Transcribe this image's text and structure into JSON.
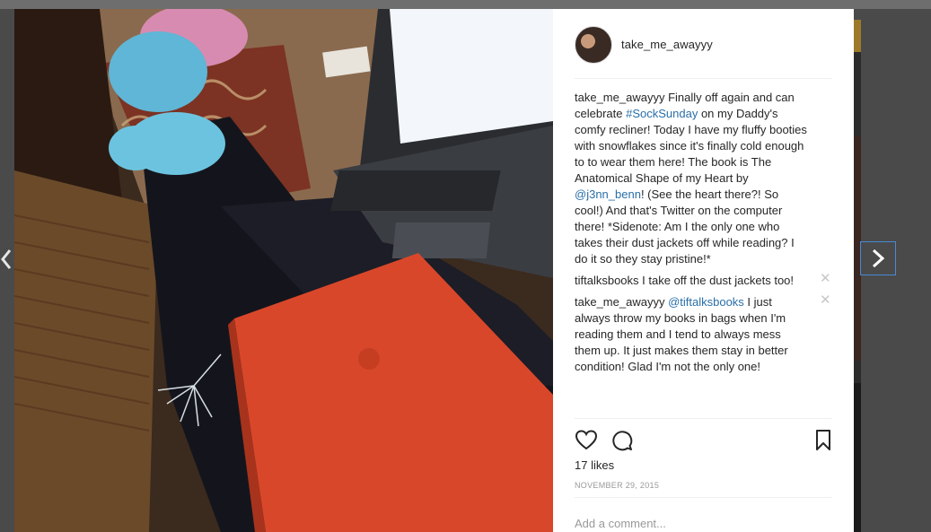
{
  "post": {
    "username": "take_me_awayyy",
    "caption": {
      "user": "take_me_awayyy",
      "text_1": " Finally off again and can celebrate ",
      "hashtag": "#SockSunday",
      "text_2": " on my Daddy's comfy recliner! Today I have my fluffy booties with snowflakes since it's finally cold enough to to wear them here! The book is The Anatomical Shape of my Heart by ",
      "mention": "@j3nn_benn",
      "text_3": "! (See the heart there?! So cool!) And that's Twitter on the computer there! *Sidenote: Am I the only one who takes their dust jackets off while reading? I do it so they stay pristine!*"
    },
    "comments": [
      {
        "user": "tiftalksbooks",
        "text": " I take off the dust jackets too!"
      },
      {
        "user": "take_me_awayyy",
        "mention": "@tiftalksbooks",
        "text": " I just always throw my books in bags when I'm reading them and I tend to always mess them up. It just makes them stay in better condition! Glad I'm not the only one!"
      }
    ],
    "delete_glyph": "✕",
    "likes": "17 likes",
    "date": "NOVEMBER 29, 2015",
    "add_comment_placeholder": "Add a comment..."
  },
  "icons": {
    "like": "heart-icon",
    "comment": "comment-icon",
    "save": "bookmark-icon",
    "prev": "chevron-left-icon",
    "next": "chevron-right-icon"
  },
  "colors": {
    "link": "#2a6fa8",
    "book": "#d9472a",
    "panel_bg": "#ffffff"
  }
}
